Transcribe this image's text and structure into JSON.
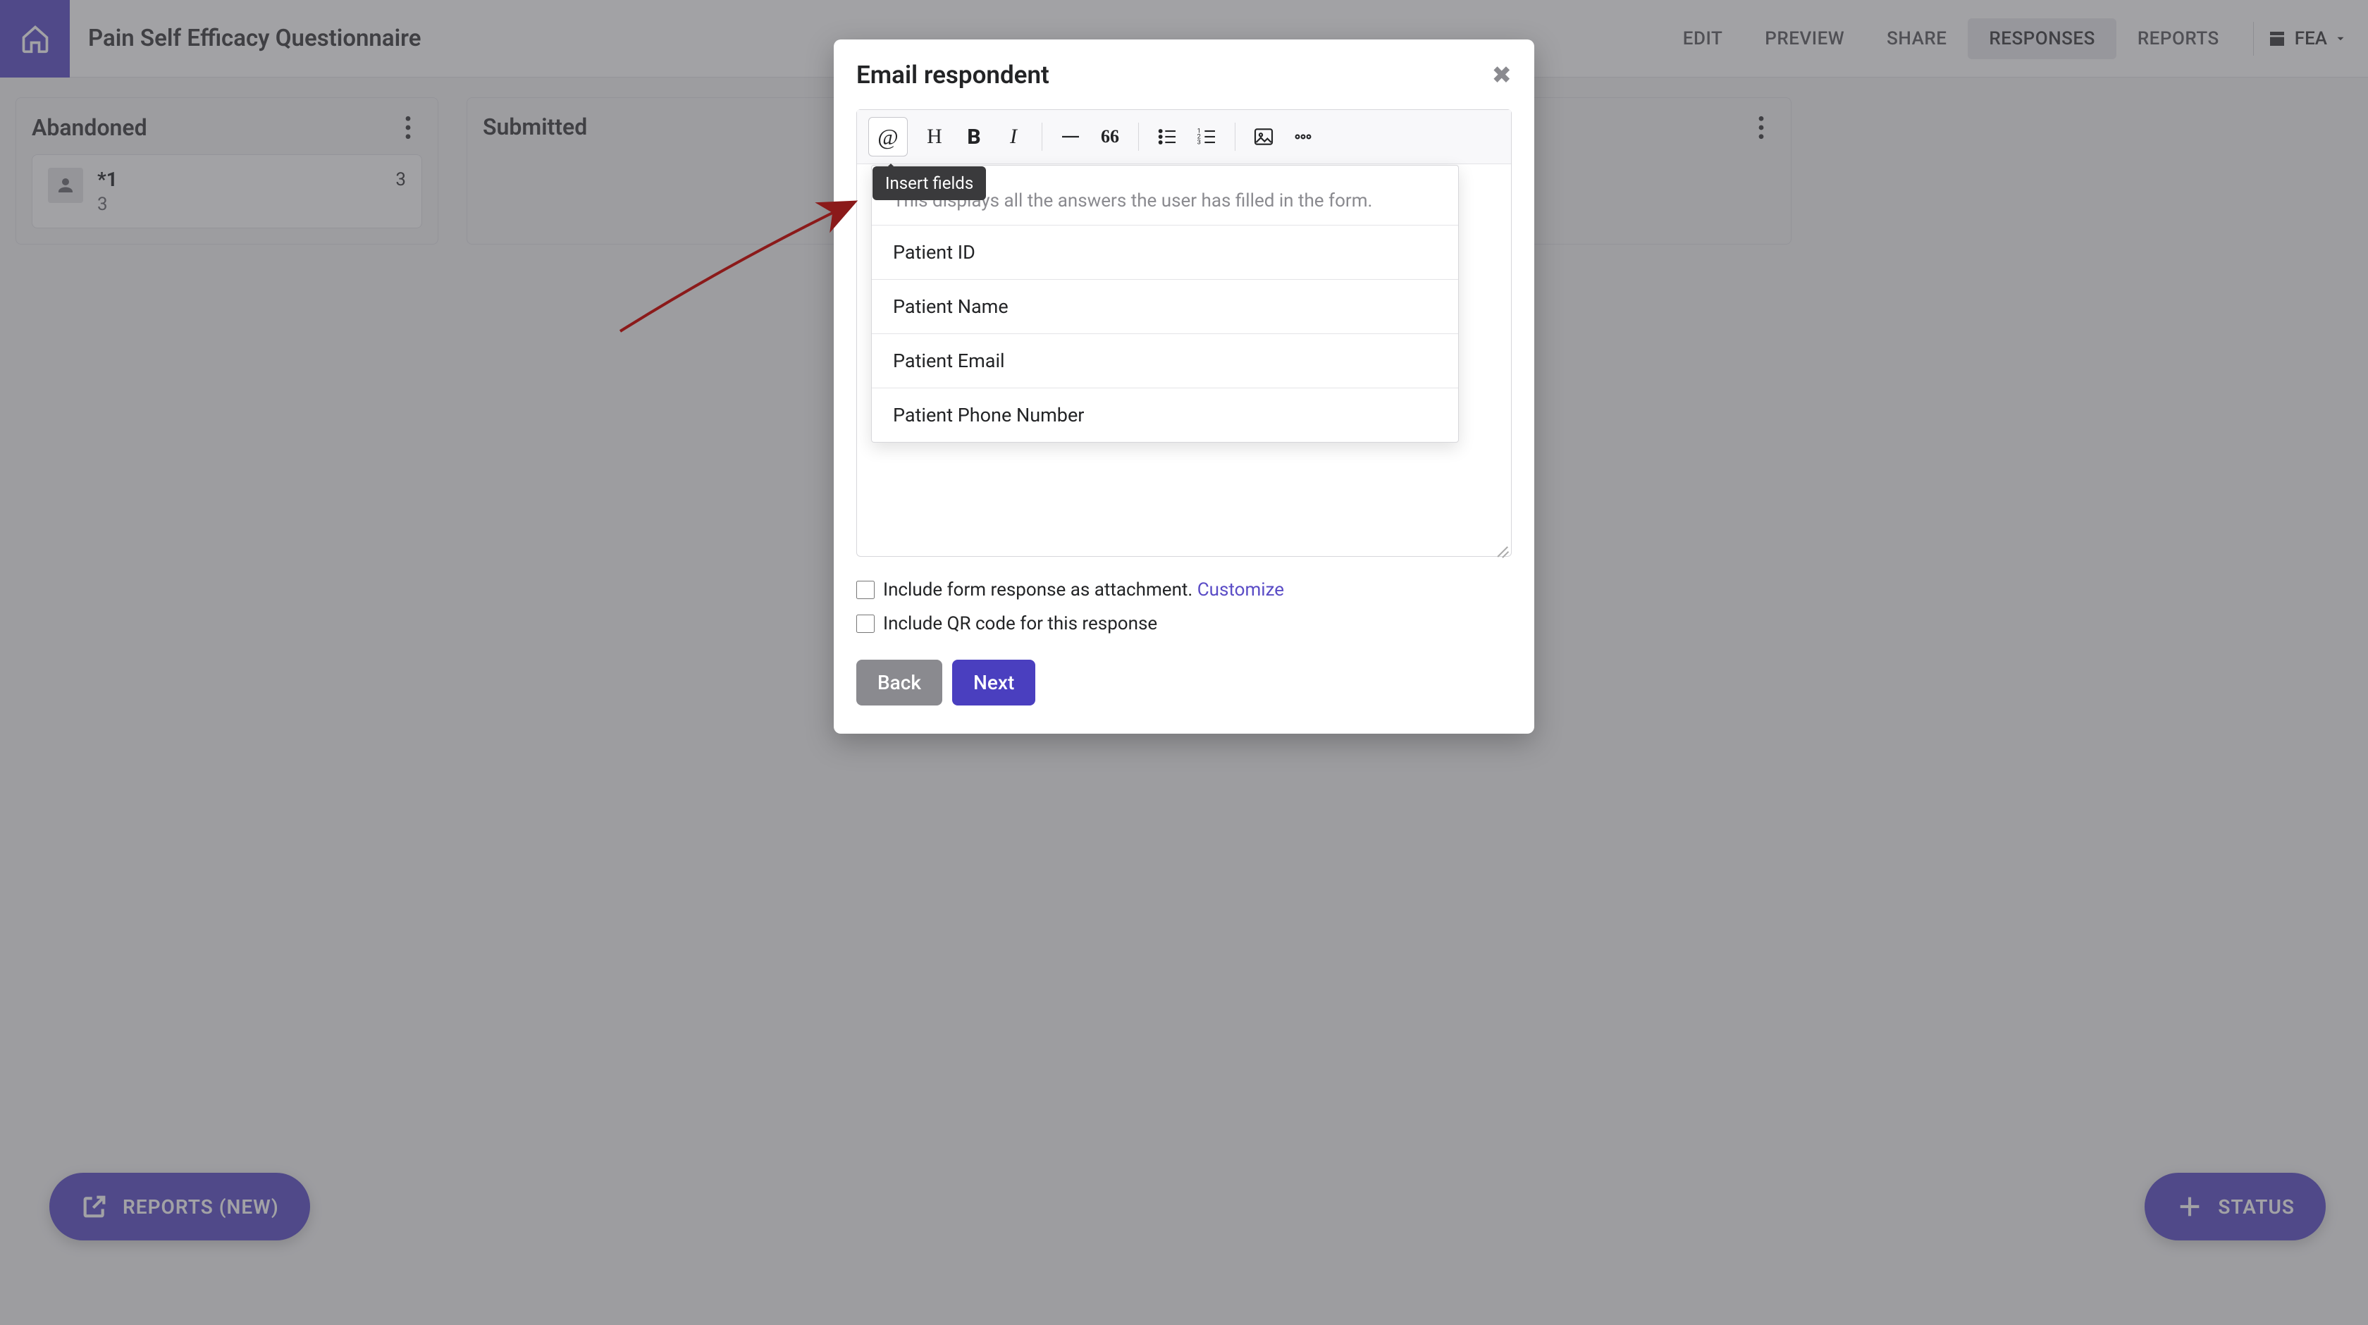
{
  "header": {
    "title": "Pain Self Efficacy Questionnaire",
    "nav": {
      "edit": "EDIT",
      "preview": "PREVIEW",
      "share": "SHARE",
      "responses": "RESPONSES",
      "reports": "REPORTS"
    },
    "workspace": "FEA"
  },
  "columns": {
    "abandoned": {
      "title": "Abandoned"
    },
    "submitted": {
      "title": "Submitted"
    }
  },
  "card": {
    "id": "*1",
    "sub": "3",
    "count": "3"
  },
  "fab": {
    "reports": "REPORTS (NEW)",
    "status": "STATUS"
  },
  "modal": {
    "title": "Email respondent",
    "tooltip": "Insert fields",
    "fields_desc": "This displays all the answers the user has filled in the form.",
    "field_items": {
      "0": "Patient ID",
      "1": "Patient Name",
      "2": "Patient Email",
      "3": "Patient Phone Number"
    },
    "check1_label": "Include form response as attachment. ",
    "check1_link": "Customize",
    "check2_label": "Include QR code for this response",
    "back": "Back",
    "next": "Next"
  }
}
